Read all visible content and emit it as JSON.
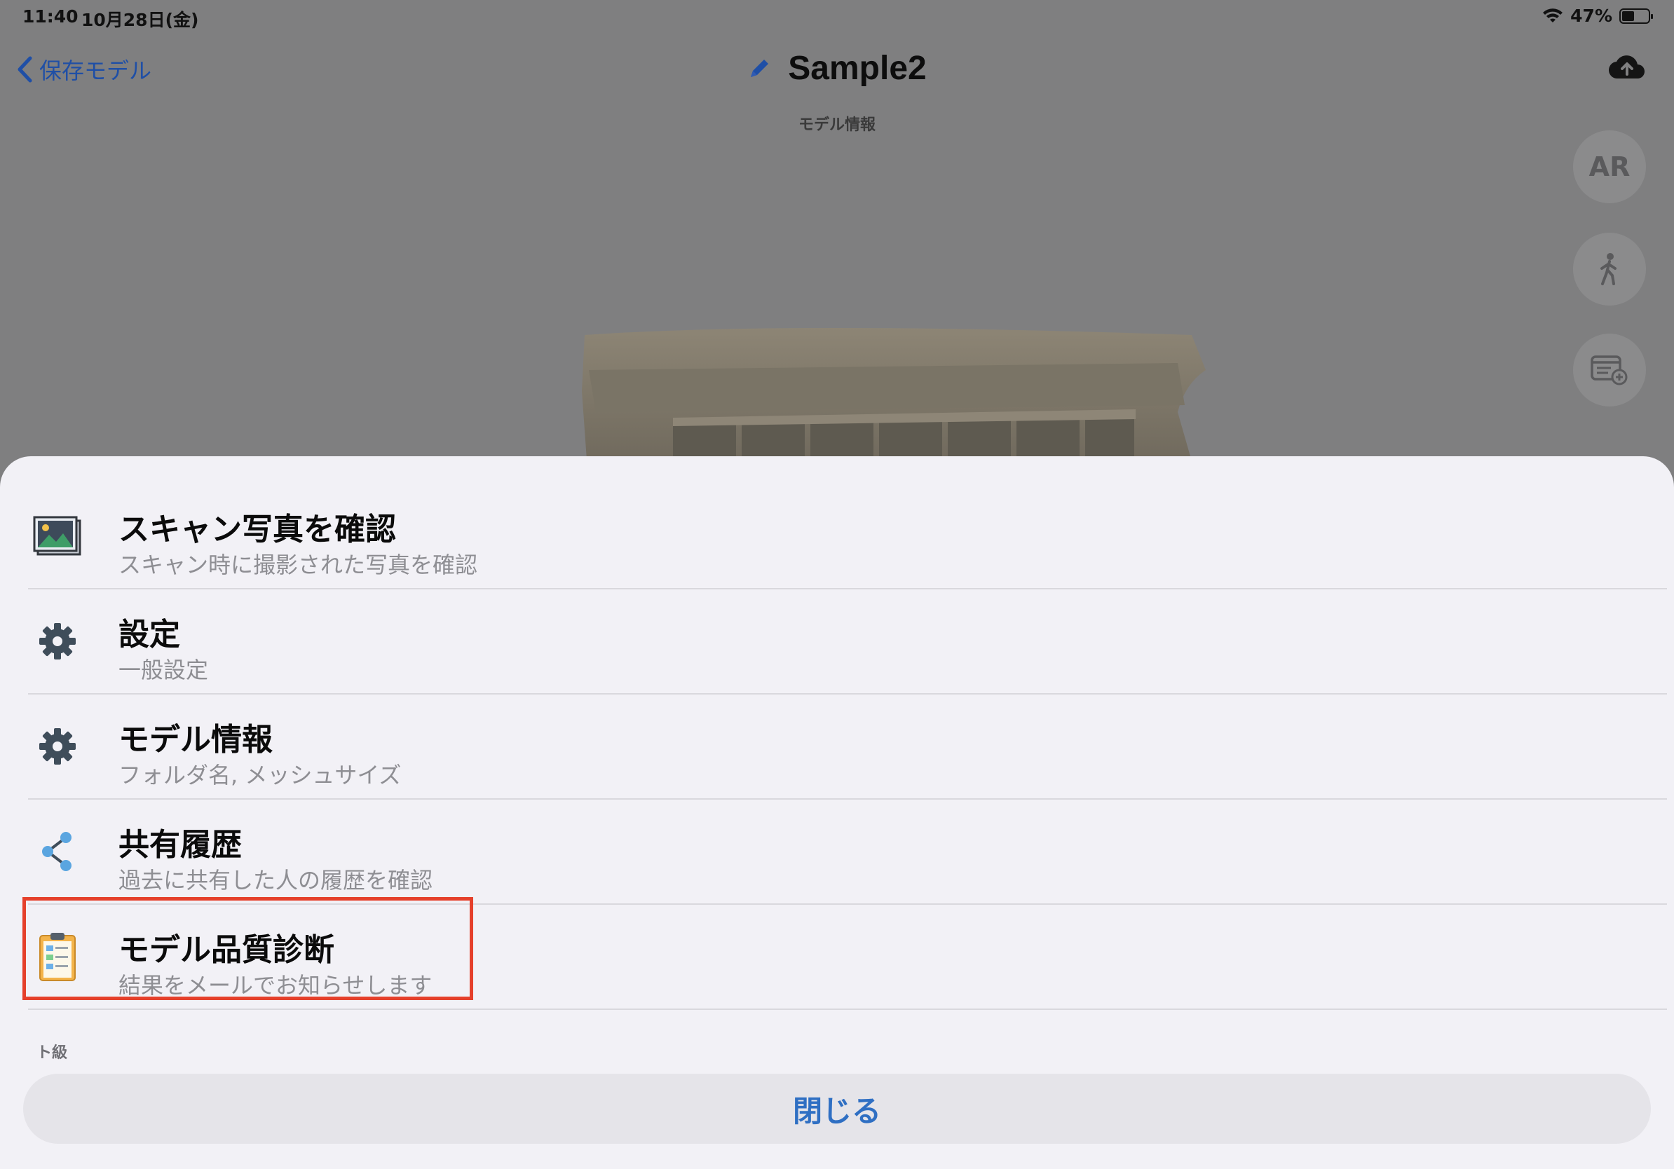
{
  "status": {
    "time": "11:40",
    "date": "10月28日(金)",
    "battery": "47%",
    "battery_level": 0.47
  },
  "nav": {
    "back_label": "保存モデル",
    "title": "Sample2",
    "subtitle": "モデル情報"
  },
  "floating_buttons": {
    "ar_label": "AR"
  },
  "menu": [
    {
      "title": "スキャン写真を確認",
      "subtitle": "スキャン時に撮影された写真を確認",
      "icon": "photo-icon"
    },
    {
      "title": "設定",
      "subtitle": "一般設定",
      "icon": "gear-icon"
    },
    {
      "title": "モデル情報",
      "subtitle": "フォルダ名, メッシュサイズ",
      "icon": "gear-icon"
    },
    {
      "title": "共有履歴",
      "subtitle": "過去に共有した人の履歴を確認",
      "icon": "share-icon"
    },
    {
      "title": "モデル品質診断",
      "subtitle": "結果をメールでお知らせします",
      "icon": "clipboard-icon"
    }
  ],
  "section_label": "ト級",
  "close_label": "閉じる",
  "colors": {
    "accent": "#2f6fc3",
    "highlight": "#e5402b"
  }
}
